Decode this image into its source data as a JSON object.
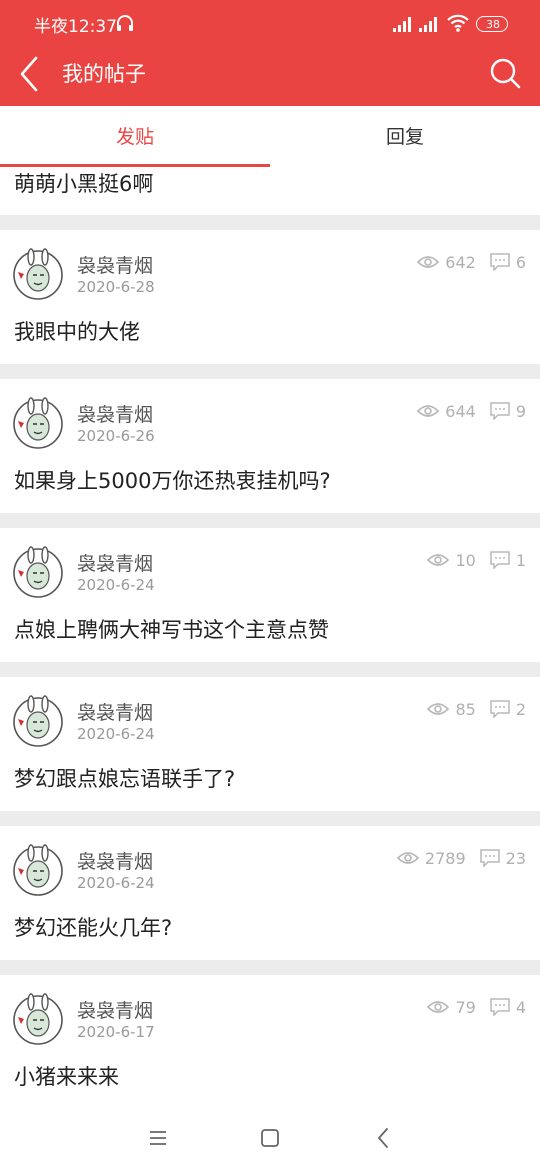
{
  "status": {
    "time": "半夜12:37",
    "battery": "38"
  },
  "header": {
    "title": "我的帖子"
  },
  "tabs": [
    {
      "label": "发贴",
      "active": true
    },
    {
      "label": "回复",
      "active": false
    }
  ],
  "partial_post": {
    "title": "萌萌小黑挺6啊"
  },
  "posts": [
    {
      "author": "袅袅青烟",
      "date": "2020-6-28",
      "views": "642",
      "comments": "6",
      "title": "我眼中的大佬"
    },
    {
      "author": "袅袅青烟",
      "date": "2020-6-26",
      "views": "644",
      "comments": "9",
      "title": "如果身上5000万你还热衷挂机吗?"
    },
    {
      "author": "袅袅青烟",
      "date": "2020-6-24",
      "views": "10",
      "comments": "1",
      "title": "点娘上聘俩大神写书这个主意点赞"
    },
    {
      "author": "袅袅青烟",
      "date": "2020-6-24",
      "views": "85",
      "comments": "2",
      "title": "梦幻跟点娘忘语联手了?"
    },
    {
      "author": "袅袅青烟",
      "date": "2020-6-24",
      "views": "2789",
      "comments": "23",
      "title": "梦幻还能火几年?"
    },
    {
      "author": "袅袅青烟",
      "date": "2020-6-17",
      "views": "79",
      "comments": "4",
      "title": "小猪来来来"
    }
  ],
  "colors": {
    "brand": "#ea4442",
    "accent": "#e94745"
  }
}
